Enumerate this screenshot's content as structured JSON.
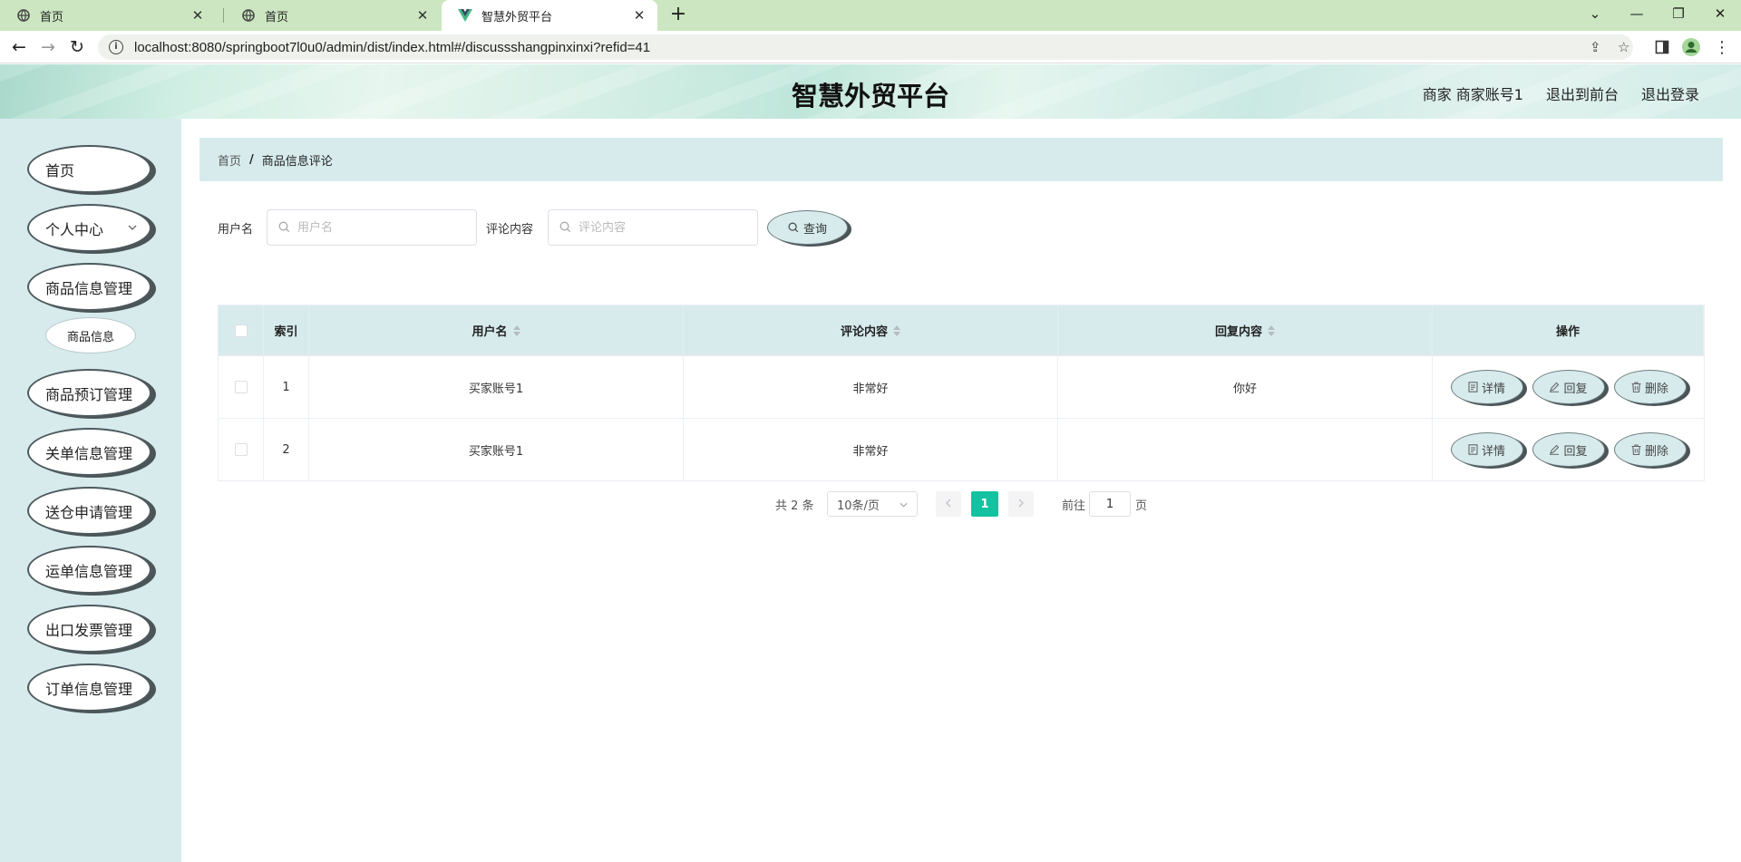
{
  "browser": {
    "tabs": [
      {
        "title": "首页",
        "active": false
      },
      {
        "title": "首页",
        "active": false
      },
      {
        "title": "智慧外贸平台",
        "active": true
      }
    ],
    "url": "localhost:8080/springboot7l0u0/admin/dist/index.html#/discussshangpinxinxi?refid=41"
  },
  "header": {
    "title": "智慧外贸平台",
    "user_label": "商家 商家账号1",
    "front_link": "退出到前台",
    "logout_link": "退出登录"
  },
  "sidebar": {
    "items": [
      {
        "label": "首页"
      },
      {
        "label": "个人中心"
      },
      {
        "label": "商品信息管理"
      },
      {
        "label": "商品预订管理"
      },
      {
        "label": "关单信息管理"
      },
      {
        "label": "送仓申请管理"
      },
      {
        "label": "运单信息管理"
      },
      {
        "label": "出口发票管理"
      },
      {
        "label": "订单信息管理"
      }
    ],
    "sub_item": "商品信息"
  },
  "breadcrumb": {
    "home": "首页",
    "sep": "/",
    "current": "商品信息评论"
  },
  "filters": {
    "username_label": "用户名",
    "username_placeholder": "用户名",
    "username_value": "",
    "content_label": "评论内容",
    "content_placeholder": "评论内容",
    "content_value": "",
    "search_button": "查询"
  },
  "table": {
    "headers": {
      "index": "索引",
      "username": "用户名",
      "content": "评论内容",
      "reply": "回复内容",
      "actions": "操作"
    },
    "rows": [
      {
        "index": "1",
        "username": "买家账号1",
        "content": "非常好",
        "reply": "你好"
      },
      {
        "index": "2",
        "username": "买家账号1",
        "content": "非常好",
        "reply": ""
      }
    ],
    "actions": {
      "detail": "详情",
      "reply": "回复",
      "delete": "删除"
    }
  },
  "pagination": {
    "total": "共 2 条",
    "page_size": "10条/页",
    "current_page": "1",
    "goto_label": "前往",
    "goto_value": "1",
    "page_unit": "页"
  },
  "colors": {
    "accent": "#13c2a0",
    "panel_bg": "#d7ebed",
    "tabbar_bg": "#cbe6c0"
  }
}
